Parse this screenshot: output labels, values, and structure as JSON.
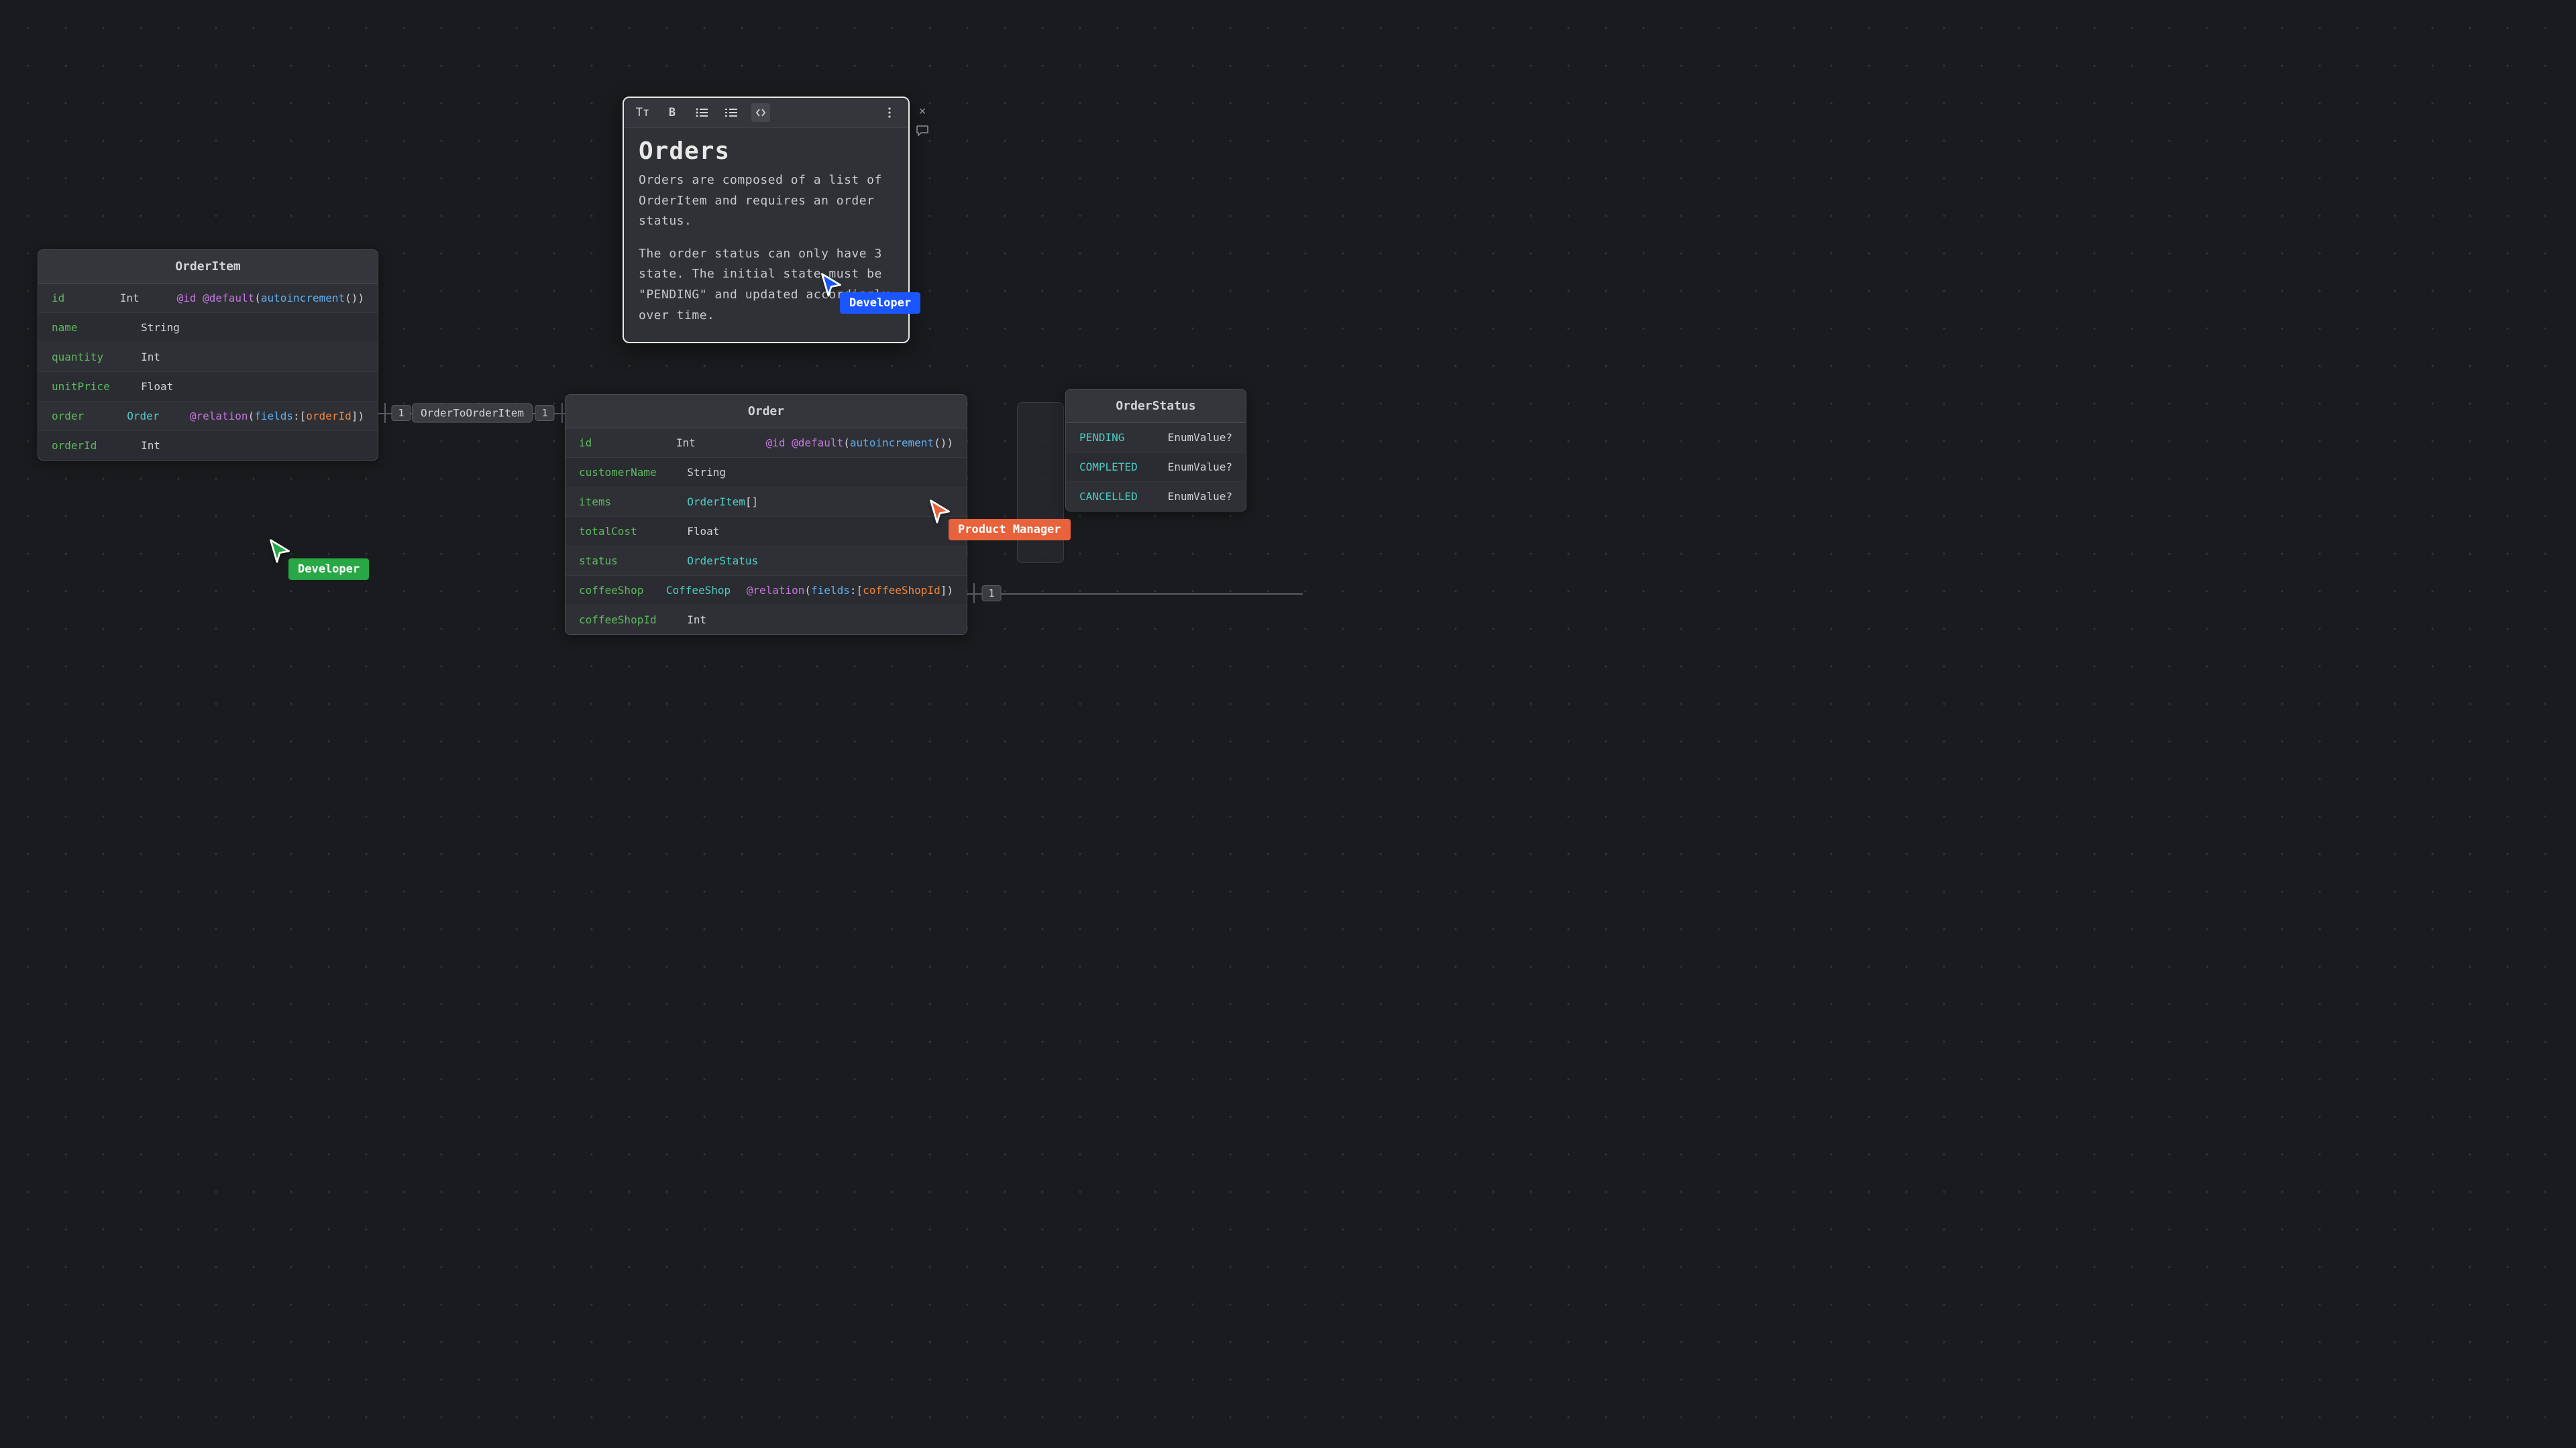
{
  "note": {
    "title": "Orders",
    "paragraph1": "Orders are composed of a list of OrderItem and requires an order status.",
    "paragraph2": "The order status can only have 3 state. The initial state must be \"PENDING\" and updated accordingly over time.",
    "toolbar": {
      "text_style": "Tт",
      "bold": "B",
      "bullets": "bulleted-list",
      "numbers": "numbered-list",
      "code": "code",
      "more": "more"
    }
  },
  "entities": {
    "orderItem": {
      "title": "OrderItem",
      "fields": [
        {
          "name": "id",
          "type": "Int",
          "attr": {
            "at1": "@id",
            "at2": "@default",
            "fn": "autoincrement"
          }
        },
        {
          "name": "name",
          "type": "String"
        },
        {
          "name": "quantity",
          "type": "Int"
        },
        {
          "name": "unitPrice",
          "type": "Float"
        },
        {
          "name": "order",
          "type": "Order",
          "attr": {
            "at1": "@relation",
            "args_kw": "fields",
            "args_ref": "orderId"
          }
        },
        {
          "name": "orderId",
          "type": "Int"
        }
      ]
    },
    "order": {
      "title": "Order",
      "fields": [
        {
          "name": "id",
          "type": "Int",
          "attr": {
            "at1": "@id",
            "at2": "@default",
            "fn": "autoincrement"
          }
        },
        {
          "name": "customerName",
          "type": "String"
        },
        {
          "name": "items",
          "type": "OrderItem",
          "type_suffix": "[]"
        },
        {
          "name": "totalCost",
          "type": "Float"
        },
        {
          "name": "status",
          "type": "OrderStatus"
        },
        {
          "name": "coffeeShop",
          "type": "CoffeeShop",
          "attr": {
            "at1": "@relation",
            "args_kw": "fields",
            "args_ref": "coffeeShopId"
          }
        },
        {
          "name": "coffeeShopId",
          "type": "Int"
        }
      ]
    },
    "orderStatus": {
      "title": "OrderStatus",
      "values": [
        {
          "name": "PENDING",
          "type": "EnumValue",
          "q": "?"
        },
        {
          "name": "COMPLETED",
          "type": "EnumValue",
          "q": "?"
        },
        {
          "name": "CANCELLED",
          "type": "EnumValue",
          "q": "?"
        }
      ]
    }
  },
  "relations": {
    "order_orderItem": {
      "label": "OrderToOrderItem",
      "left": "1",
      "right": "1"
    },
    "order_right": {
      "label": "1"
    }
  },
  "cursors": {
    "blue": {
      "label": "Developer",
      "color": "#1a56ff"
    },
    "green": {
      "label": "Developer",
      "color": "#28a745"
    },
    "orange": {
      "label": "Product Manager",
      "color": "#e8623b"
    }
  }
}
